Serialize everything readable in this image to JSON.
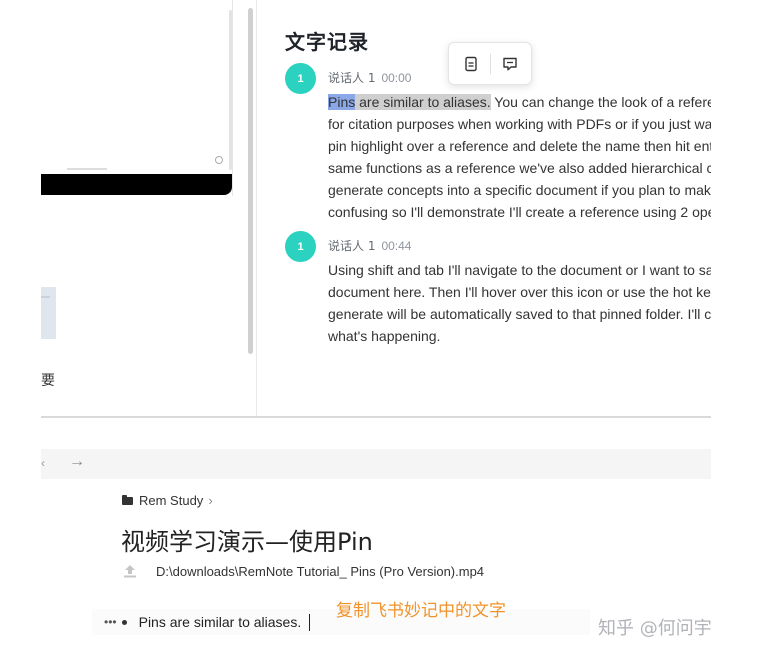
{
  "minutes": {
    "title": "文字记录",
    "left_pane_label": "要",
    "segments": [
      {
        "avatar": "1",
        "speaker": "说话人 1",
        "timestamp": "00:00",
        "highlight_word": "Pins",
        "highlight_rest": " are similar to aliases.",
        "first_line_rest": " You can change the look of a refere",
        "lines": [
          "for citation purposes when working with PDFs or if you just wa",
          "pin highlight over a reference and delete the name then hit ent",
          "same functions as a reference we've also added hierarchical c",
          "generate concepts into a specific document if you plan to mak",
          "confusing so I'll demonstrate I'll create a reference using 2 ope"
        ]
      },
      {
        "avatar": "1",
        "speaker": "说话人 1",
        "timestamp": "00:44",
        "lines": [
          "Using shift and tab I'll navigate to the document or I want to sa",
          "document here. Then I'll hover over this icon or use the hot ke",
          "generate will be automatically saved to that pinned folder. I'll c",
          "what's happening."
        ]
      }
    ],
    "toolbar": {
      "doc_icon": "document-icon",
      "comment_icon": "comment-icon"
    }
  },
  "remnote": {
    "nav_forward": "→",
    "breadcrumb": "Rem Study",
    "breadcrumb_chevron": "›",
    "doc_title": "视频学习演示—使用Pin",
    "file_path": "D:\\downloads\\RemNote Tutorial_ Pins (Pro Version).mp4",
    "drag_handle": "•••",
    "bullet_text": "Pins are similar to aliases."
  },
  "overlay_caption": "复制飞书妙记中的文字",
  "watermark": "知乎 @何问宇",
  "colors": {
    "avatar": "#2bd2c0",
    "word_highlight": "#8aa7e8",
    "sentence_highlight": "#cfcfcf",
    "caption": "#f0932b"
  }
}
